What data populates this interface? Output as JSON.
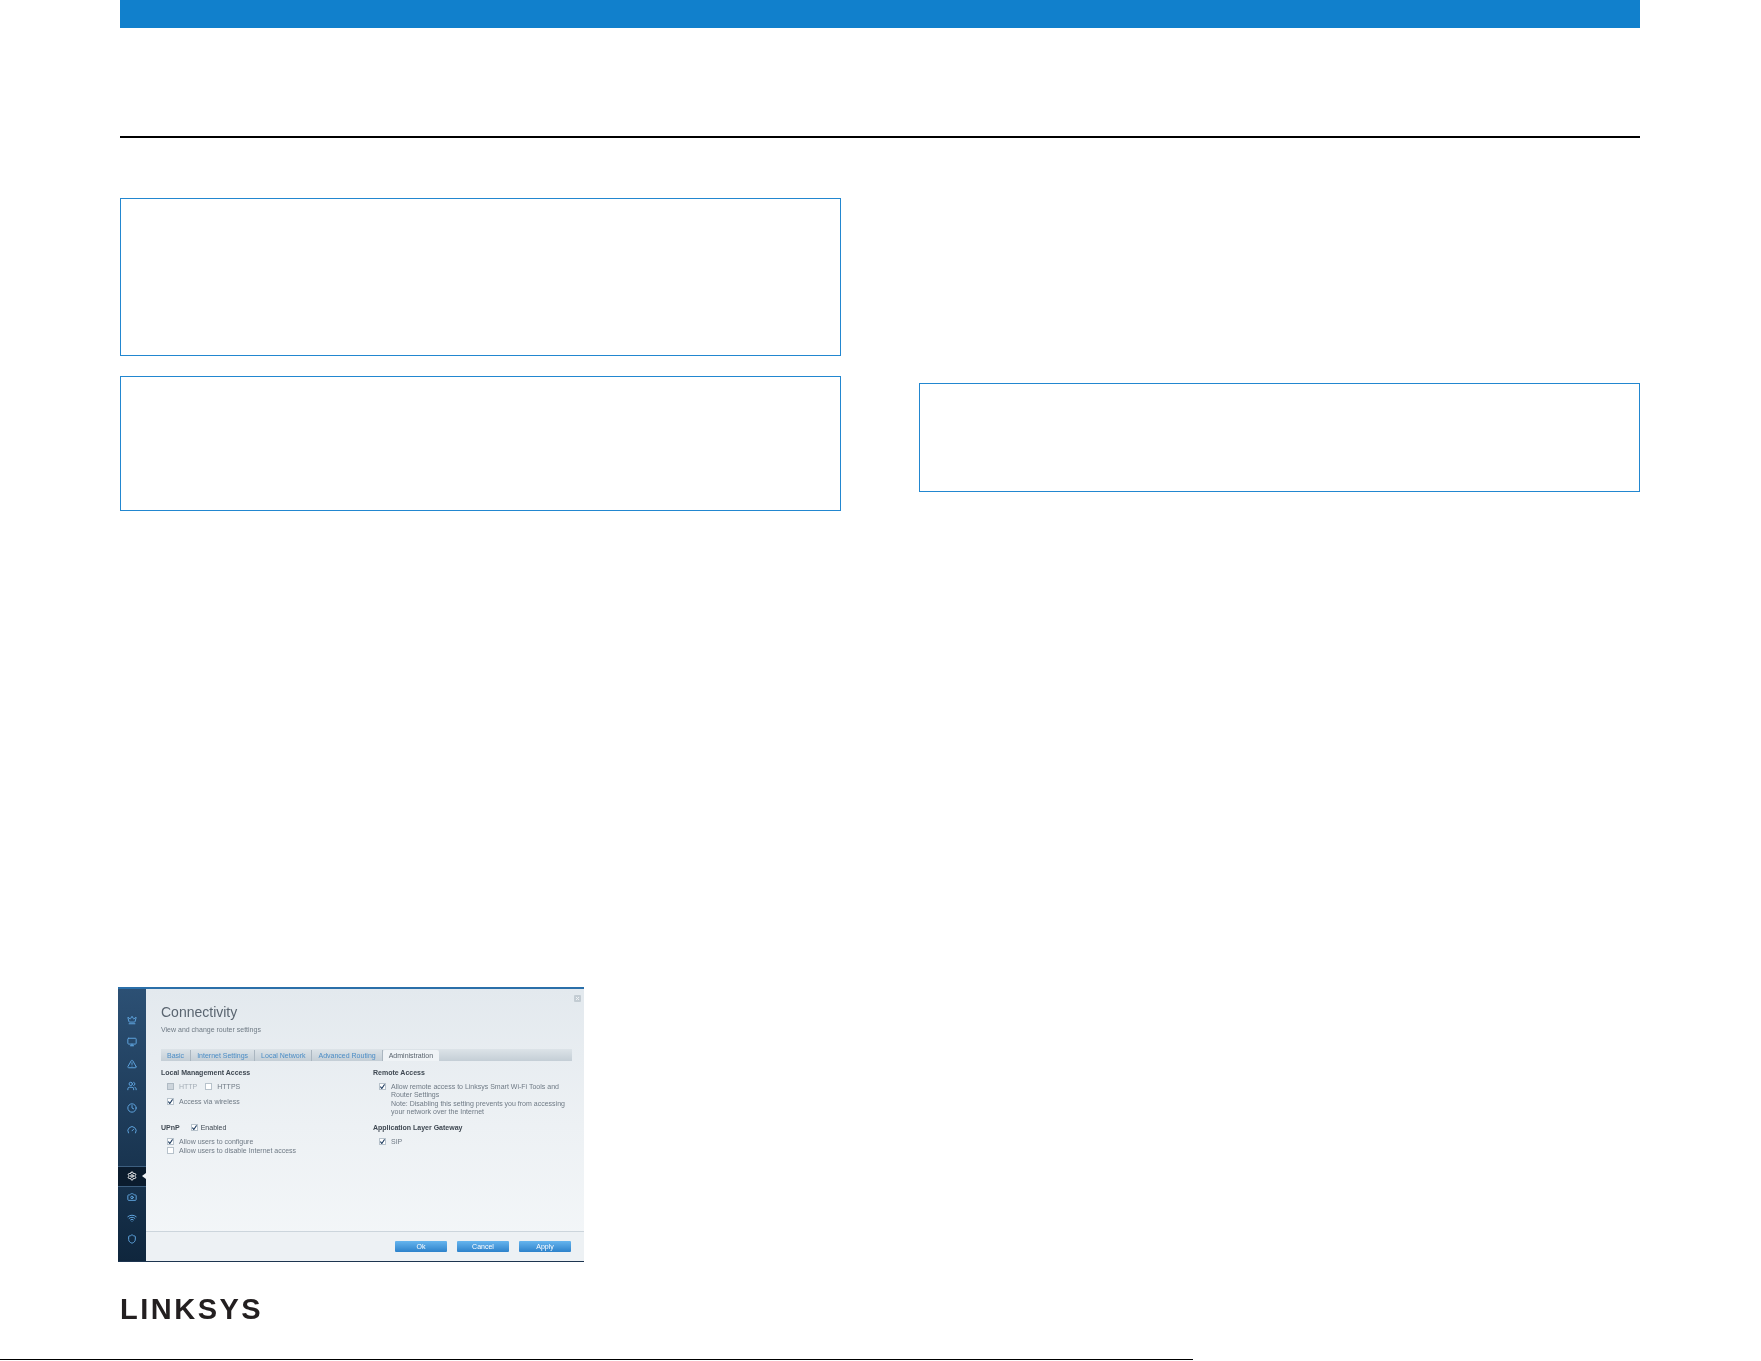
{
  "app_screenshot": {
    "sidebar": {
      "top_items": [
        {
          "selected": false
        },
        {
          "selected": false
        },
        {
          "selected": false
        },
        {
          "selected": false
        },
        {
          "selected": false
        },
        {
          "selected": false
        }
      ],
      "bottom_items": [
        {
          "selected": true
        },
        {
          "selected": false
        },
        {
          "selected": false
        },
        {
          "selected": false
        }
      ]
    },
    "title": "Connectivity",
    "subtitle": "View and change router settings",
    "tabs": [
      {
        "label": "Basic",
        "selected": false
      },
      {
        "label": "Internet Settings",
        "selected": false
      },
      {
        "label": "Local Network",
        "selected": false
      },
      {
        "label": "Advanced Routing",
        "selected": false
      },
      {
        "label": "Administration",
        "selected": true
      }
    ],
    "columns": [
      [
        {
          "heading": "Local Management Access",
          "rows": [
            [
              {
                "label": "HTTP",
                "checked": false,
                "disabled": true
              },
              {
                "label": "HTTPS",
                "checked": false,
                "disabled": false
              }
            ],
            [
              {
                "label": "Access via wireless",
                "checked": true,
                "disabled": false
              }
            ]
          ]
        },
        {
          "heading": "UPnP",
          "toggle": {
            "label": "Enabled",
            "checked": true
          },
          "rows": [
            [
              {
                "label": "Allow users to configure",
                "checked": true,
                "disabled": false
              }
            ],
            [
              {
                "label": "Allow users to disable Internet access",
                "checked": false,
                "disabled": false
              }
            ]
          ]
        }
      ],
      [
        {
          "heading": "Remote Access",
          "rows": [
            [
              {
                "label": "Allow remote access to Linksys Smart Wi-Fi Tools and Router Settings",
                "checked": true,
                "disabled": false
              }
            ]
          ],
          "note": "Note: Disabling this setting prevents you from accessing your network over the Internet"
        },
        {
          "heading": "Application Layer Gateway",
          "rows": [
            [
              {
                "label": "SIP",
                "checked": true,
                "disabled": false
              }
            ]
          ]
        }
      ]
    ],
    "buttons": [
      "Ok",
      "Cancel",
      "Apply"
    ]
  },
  "logo": "LINKSYS"
}
